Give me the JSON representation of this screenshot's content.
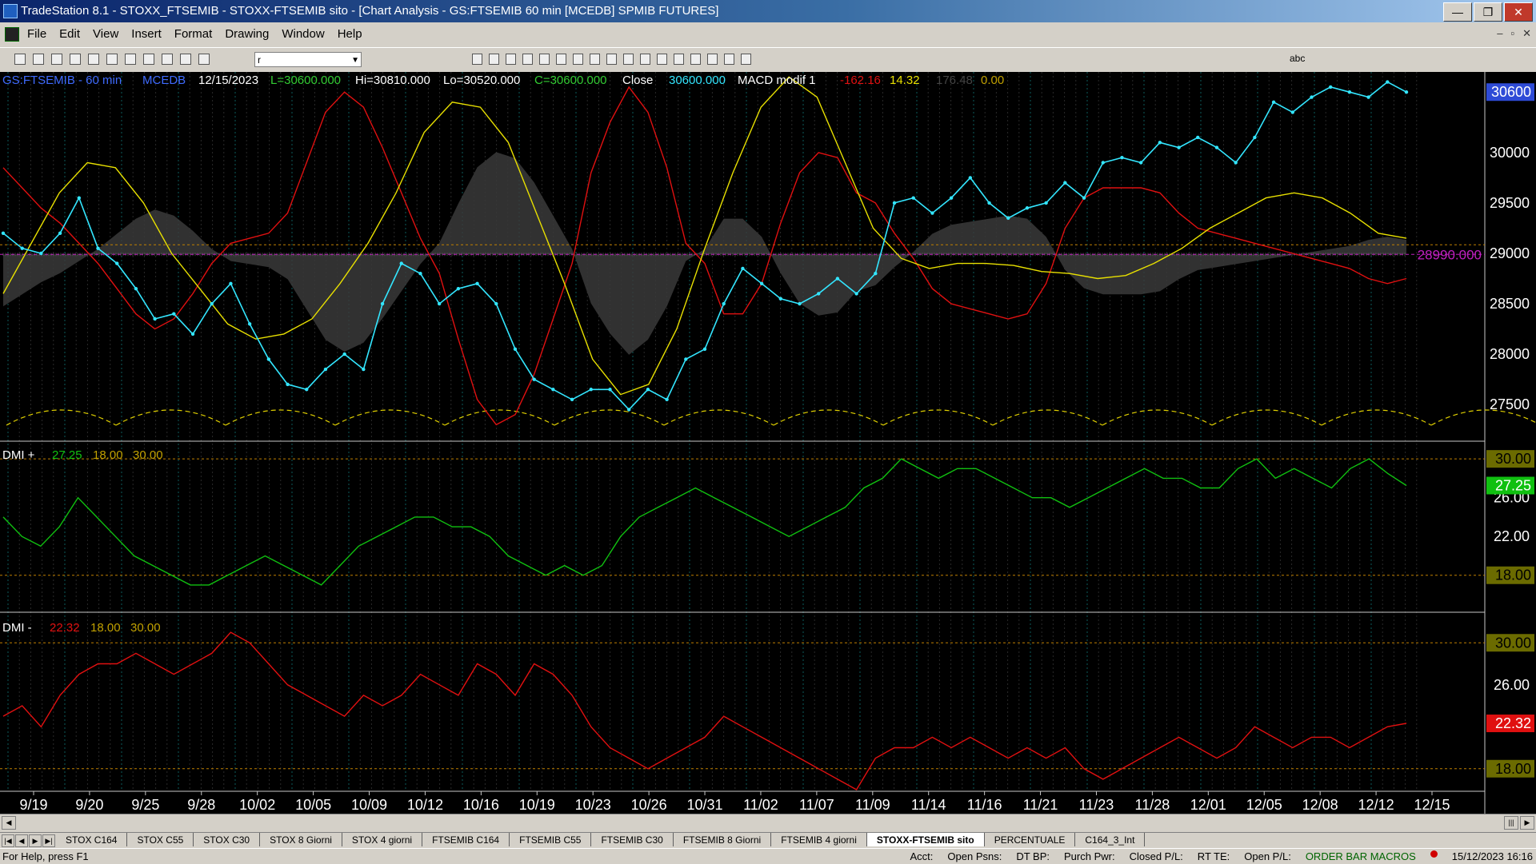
{
  "window": {
    "title": "TradeStation 8.1 - STOXX_FTSEMIB - STOXX-FTSEMIB sito - [Chart Analysis - GS:FTSEMIB  60 min  [MCEDB] SPMIB FUTURES]",
    "min": "—",
    "max": "❐",
    "close": "✕"
  },
  "menu": {
    "items": [
      "File",
      "Edit",
      "View",
      "Insert",
      "Format",
      "Drawing",
      "Window",
      "Help"
    ],
    "mdi": [
      "–",
      "▫",
      "✕"
    ]
  },
  "toolbar": {
    "combo_value": "r",
    "text_tool": "abc"
  },
  "legend": {
    "symbol": "GS:FTSEMIB - 60 min",
    "indicator": "MCEDB",
    "date": "12/15/2023",
    "last": "L=30600.000",
    "high": "Hi=30810.000",
    "low": "Lo=30520.000",
    "close": "C=30600.000",
    "close_label": "Close",
    "close_value": "30600.000",
    "macd_label": "MACD modif 1",
    "macd_a": "-162.16",
    "macd_b": "14.32",
    "macd_c": "176.48",
    "macd_d": "0.00"
  },
  "dmi_plus_legend": {
    "label": "DMI +",
    "value": "27.25",
    "low": "18.00",
    "high": "30.00"
  },
  "dmi_minus_legend": {
    "label": "DMI -",
    "value": "22.32",
    "low": "18.00",
    "high": "30.00"
  },
  "colors": {
    "price": "#33e6ff",
    "red_line": "#e01010",
    "yellow_line": "#e8e000",
    "dmi_plus": "#10c010",
    "dmi_minus": "#e01010",
    "level_line": "#c08000",
    "ref_line": "#c020c0",
    "bg": "#000000"
  },
  "chart_data": [
    {
      "type": "line",
      "title": "GS:FTSEMIB - 60 min",
      "x_ticks": [
        "9/19",
        "9/20",
        "9/25",
        "9/28",
        "10/02",
        "10/05",
        "10/09",
        "10/12",
        "10/16",
        "10/19",
        "10/23",
        "10/26",
        "10/31",
        "11/02",
        "11/07",
        "11/09",
        "11/14",
        "11/16",
        "11/21",
        "11/23",
        "11/28",
        "12/01",
        "12/05",
        "12/08",
        "12/12",
        "12/15"
      ],
      "ylim": [
        27200,
        30800
      ],
      "y_ticks": [
        "27500",
        "28000",
        "28500",
        "29000",
        "29500",
        "30000"
      ],
      "last_value_label": "30600",
      "reference_label": "28990.000",
      "reference_value": 28990,
      "series": [
        {
          "name": "Close",
          "values": [
            29200,
            29050,
            29000,
            29200,
            29550,
            29050,
            28900,
            28650,
            28350,
            28400,
            28200,
            28500,
            28700,
            28300,
            27950,
            27700,
            27650,
            27850,
            28000,
            27850,
            28500,
            28900,
            28800,
            28500,
            28650,
            28700,
            28500,
            28050,
            27750,
            27650,
            27550,
            27650,
            27650,
            27450,
            27650,
            27550,
            27950,
            28050,
            28500,
            28850,
            28700,
            28550,
            28500,
            28600,
            28750,
            28600,
            28800,
            29500,
            29550,
            29400,
            29550,
            29750,
            29500,
            29350,
            29450,
            29500,
            29700,
            29550,
            29900,
            29950,
            29900,
            30100,
            30050,
            30150,
            30050,
            29900,
            30150,
            30500,
            30400,
            30550,
            30650,
            30600,
            30550,
            30700,
            30600
          ]
        },
        {
          "name": "MACD modif 1",
          "values": [
            29850,
            29650,
            29450,
            29300,
            29100,
            28900,
            28650,
            28400,
            28250,
            28350,
            28600,
            28900,
            29100,
            29150,
            29200,
            29400,
            29900,
            30400,
            30600,
            30450,
            30050,
            29600,
            29150,
            28800,
            28150,
            27550,
            27300,
            27400,
            27800,
            28350,
            28900,
            29800,
            30300,
            30650,
            30400,
            29850,
            29100,
            28900,
            28400,
            28400,
            28700,
            29300,
            29800,
            30000,
            29950,
            29600,
            29500,
            29200,
            28950,
            28650,
            28500,
            28450,
            28400,
            28350,
            28400,
            28700,
            29250,
            29550,
            29650,
            29650,
            29650,
            29600,
            29400,
            29250,
            29200,
            29150,
            29100,
            29050,
            29000,
            28950,
            28900,
            28850,
            28750,
            28700,
            28750
          ]
        },
        {
          "name": "",
          "values": [
            28600,
            29100,
            29600,
            29900,
            29850,
            29500,
            29000,
            28650,
            28300,
            28150,
            28200,
            28350,
            28700,
            29100,
            29600,
            30200,
            30500,
            30450,
            30100,
            29400,
            28700,
            27950,
            27600,
            27700,
            28250,
            29050,
            29800,
            30450,
            30750,
            30550,
            29900,
            29250,
            28950,
            28850,
            28900,
            28900,
            28880,
            28820,
            28800,
            28750,
            28780,
            28900,
            29050,
            29250,
            29400,
            29550,
            29600,
            29550,
            29400,
            29200,
            29150
          ]
        }
      ]
    },
    {
      "type": "line",
      "title": "DMI +",
      "ylim": [
        16,
        31
      ],
      "y_ticks": [
        "18.00",
        "22.00",
        "26.00",
        "30.00"
      ],
      "last_value_label": "27.25",
      "levels": [
        18,
        30
      ],
      "series": [
        {
          "name": "DMI +",
          "values": [
            24,
            22,
            21,
            23,
            26,
            24,
            22,
            20,
            19,
            18,
            17,
            17,
            18,
            19,
            20,
            19,
            18,
            17,
            19,
            21,
            22,
            23,
            24,
            24,
            23,
            23,
            22,
            20,
            19,
            18,
            19,
            18,
            19,
            22,
            24,
            25,
            26,
            27,
            26,
            25,
            24,
            23,
            22,
            23,
            24,
            25,
            27,
            28,
            30,
            29,
            28,
            29,
            29,
            28,
            27,
            26,
            26,
            25,
            26,
            27,
            28,
            29,
            28,
            28,
            27,
            27,
            29,
            30,
            28,
            29,
            28,
            27,
            29,
            30,
            28.5,
            27.25
          ]
        }
      ]
    },
    {
      "type": "line",
      "title": "DMI -",
      "ylim": [
        16,
        32
      ],
      "y_ticks": [
        "18.00",
        "26.00",
        "30.00"
      ],
      "last_value_label": "22.32",
      "levels": [
        18,
        30
      ],
      "series": [
        {
          "name": "DMI -",
          "values": [
            23,
            24,
            22,
            25,
            27,
            28,
            28,
            29,
            28,
            27,
            28,
            29,
            31,
            30,
            28,
            26,
            25,
            24,
            23,
            25,
            24,
            25,
            27,
            26,
            25,
            28,
            27,
            25,
            28,
            27,
            25,
            22,
            20,
            19,
            18,
            19,
            20,
            21,
            23,
            22,
            21,
            20,
            19,
            18,
            17,
            16,
            19,
            20,
            20,
            21,
            20,
            21,
            20,
            19,
            20,
            19,
            20,
            18,
            17,
            18,
            19,
            20,
            21,
            20,
            19,
            20,
            22,
            21,
            20,
            21,
            21,
            20,
            21,
            22,
            22.32
          ]
        }
      ]
    }
  ],
  "tabs": {
    "nav": [
      "|◀",
      "◀",
      "▶",
      "▶|"
    ],
    "items": [
      "STOX C164",
      "STOX C55",
      "STOX  C30",
      "STOX  8 Giorni",
      "STOX 4 giorni",
      "FTSEMIB C164",
      "FTSEMIB C55",
      "FTSEMIB C30",
      "FTSEMIB  8 Giorni",
      "FTSEMIB  4 giorni",
      "STOXX-FTSEMIB sito",
      "PERCENTUALE",
      "C164_3_Int"
    ],
    "active": 10
  },
  "status": {
    "help": "For Help, press F1",
    "fields": [
      "Acct:",
      "Open Psns:",
      "DT BP:",
      "Purch Pwr:",
      "Closed P/L:",
      "RT TE:",
      "Open P/L:"
    ],
    "macros": "ORDER BAR  MACROS",
    "datetime": "15/12/2023 16:16"
  }
}
